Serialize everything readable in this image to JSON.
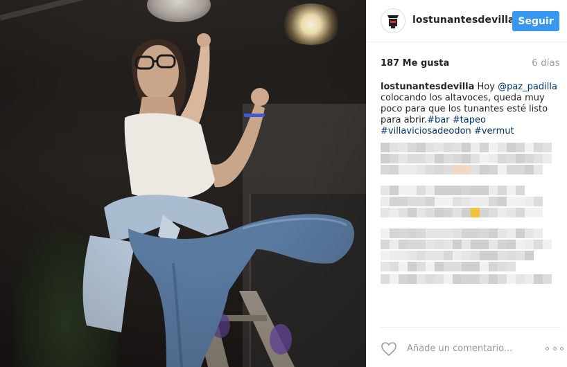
{
  "header": {
    "username": "lostunantesdevilla",
    "follow_label": "Seguir"
  },
  "stats": {
    "likes": "187 Me gusta",
    "time_ago": "6 días"
  },
  "caption": {
    "username": "lostunantesdevilla",
    "text_intro": "Hoy ",
    "mention": "@paz_padilla",
    "text_body": "colocando los altavoces, queda muy poco para que los tunantes esté listo para abrir.",
    "hashtags": [
      "#bar",
      "#tapeo",
      "#villaviciosadeodon",
      "#vermut"
    ]
  },
  "comments": {
    "state": "pixelated"
  },
  "footer": {
    "comment_placeholder": "Añade un comentario..."
  },
  "colors": {
    "accent": "#3897f0",
    "link": "#003569",
    "muted": "#999999",
    "text": "#262626"
  },
  "icons": {
    "avatar": "shop-logo-icon",
    "heart": "heart-outline-icon",
    "more": "more-options-icon"
  }
}
